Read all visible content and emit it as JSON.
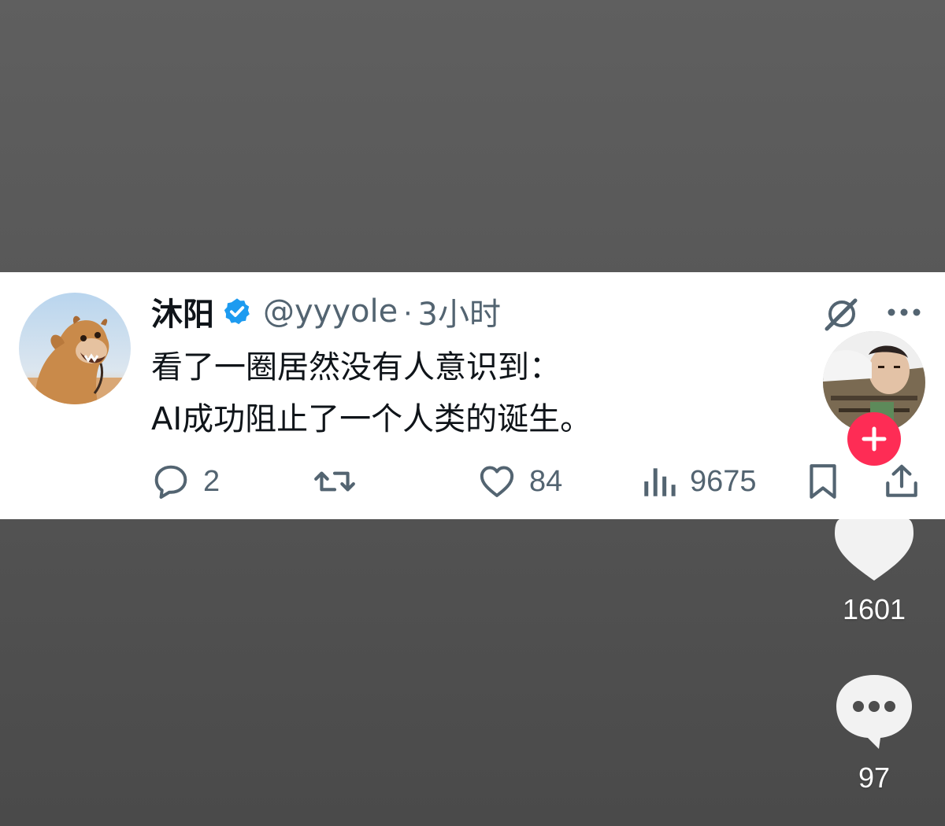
{
  "tweet": {
    "author": {
      "display_name": "沐阳",
      "handle": "@yyyole",
      "verified": true,
      "verified_color": "#1d9bf0",
      "avatar": "camel-avatar"
    },
    "separator": "·",
    "time": "3小时",
    "text_lines": [
      "看了一圈居然没有人意识到：",
      "AI成功阻止了一个人类的诞生。"
    ],
    "actions": {
      "reply_count": "2",
      "retweet_count": "",
      "like_count": "84",
      "views_count": "9675"
    },
    "icons": {
      "grok": "grok-icon",
      "more": "more-icon",
      "reply": "reply-icon",
      "retweet": "retweet-icon",
      "like": "heart-icon",
      "views": "views-icon",
      "bookmark": "bookmark-icon",
      "share": "share-icon"
    }
  },
  "video_sidebar": {
    "creator_avatar": "creator-avatar",
    "follow_color": "#fe2c55",
    "like_count": "1601",
    "comment_count": "97"
  }
}
